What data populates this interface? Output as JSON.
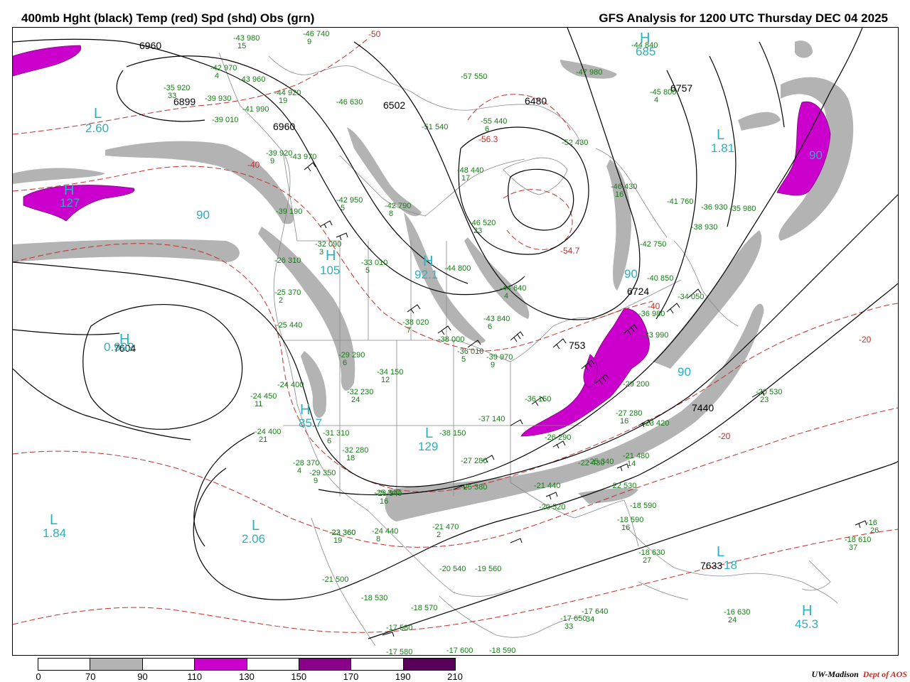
{
  "title_left": "400mb Hght (black) Temp (red) Spd (shd) Obs (grn)",
  "title_right": "GFS Analysis for 1200 UTC Thursday  DEC 04 2025",
  "colors": {
    "height_contour": "#000000",
    "temp_contour": "#c0302a",
    "speed_70_90": "#b3b3b3",
    "speed_110_130": "#cc00cc",
    "obs": "#1a7a1a",
    "pressure_centers": "#2ab0c0",
    "borders": "#888888"
  },
  "legend": {
    "ticks": [
      "0",
      "70",
      "90",
      "110",
      "130",
      "150",
      "170",
      "190",
      "210"
    ],
    "segment_colors": [
      "#ffffff",
      "#b3b3b3",
      "#ffffff",
      "#cc00cc",
      "#ffffff",
      "#8a008a",
      "#ffffff",
      "#5a005a"
    ]
  },
  "credit": {
    "org": "UW-Madison",
    "dept": "Dept of AOS"
  },
  "height_labels": [
    "6960",
    "6960",
    "6899",
    "6502",
    "6480",
    "6757",
    "6724",
    "7604",
    "7440",
    "7633",
    "753"
  ],
  "speed_labels": [
    "90",
    "90",
    "90",
    "90"
  ],
  "temp_labels": [
    "-50",
    "-40",
    "-54.7",
    "-56.3",
    "-40",
    "-20",
    "-20"
  ],
  "centers": [
    {
      "letter": "L",
      "value": "2.60"
    },
    {
      "letter": "H",
      "value": "127"
    },
    {
      "letter": "L",
      "value": "1.81"
    },
    {
      "letter": "H",
      "value": "0.992"
    },
    {
      "letter": "L",
      "value": "1.84"
    },
    {
      "letter": "L",
      "value": "2.06"
    },
    {
      "letter": "L",
      "value": "129"
    },
    {
      "letter": "H",
      "value": "85.7"
    },
    {
      "letter": "H",
      "value": "45.3"
    },
    {
      "letter": "L",
      "value": "18"
    },
    {
      "letter": "H",
      "value": "105"
    },
    {
      "letter": "H",
      "value": "92.1"
    },
    {
      "letter": "H",
      "value": "685"
    }
  ],
  "observations": [
    {
      "temp": "-43",
      "hgt": "980",
      "dew": "15"
    },
    {
      "temp": "-46",
      "hgt": "740",
      "dew": "9"
    },
    {
      "temp": "-42",
      "hgt": "970",
      "dew": "4"
    },
    {
      "temp": "-43",
      "hgt": "960",
      "dew": ""
    },
    {
      "temp": "-35",
      "hgt": "920",
      "dew": "33"
    },
    {
      "temp": "-39",
      "hgt": "930",
      "dew": ""
    },
    {
      "temp": "-44",
      "hgt": "920",
      "dew": "19"
    },
    {
      "temp": "-46",
      "hgt": "630",
      "dew": ""
    },
    {
      "temp": "-57",
      "hgt": "550",
      "dew": ""
    },
    {
      "temp": "-44",
      "hgt": "840",
      "dew": ""
    },
    {
      "temp": "-47",
      "hgt": "980",
      "dew": ""
    },
    {
      "temp": "-45",
      "hgt": "800",
      "dew": "4"
    },
    {
      "temp": "-41",
      "hgt": "990",
      "dew": ""
    },
    {
      "temp": "-39",
      "hgt": "010",
      "dew": ""
    },
    {
      "temp": "-51",
      "hgt": "540",
      "dew": ""
    },
    {
      "temp": "-55",
      "hgt": "440",
      "dew": "6"
    },
    {
      "temp": "-52",
      "hgt": "430",
      "dew": ""
    },
    {
      "temp": "-36",
      "hgt": "930",
      "dew": ""
    },
    {
      "temp": "-39",
      "hgt": "920",
      "dew": "9"
    },
    {
      "temp": "-43",
      "hgt": "970",
      "dew": ""
    },
    {
      "temp": "-48",
      "hgt": "440",
      "dew": "17"
    },
    {
      "temp": "-46",
      "hgt": "430",
      "dew": "16"
    },
    {
      "temp": "-41",
      "hgt": "760",
      "dew": ""
    },
    {
      "temp": "-35",
      "hgt": "980",
      "dew": ""
    },
    {
      "temp": "-42",
      "hgt": "950",
      "dew": "5"
    },
    {
      "temp": "-42",
      "hgt": "790",
      "dew": "8"
    },
    {
      "temp": "-46",
      "hgt": "520",
      "dew": "23"
    },
    {
      "temp": "-38",
      "hgt": "930",
      "dew": ""
    },
    {
      "temp": "-39",
      "hgt": "190",
      "dew": ""
    },
    {
      "temp": "-32",
      "hgt": "090",
      "dew": "3"
    },
    {
      "temp": "-42",
      "hgt": "750",
      "dew": ""
    },
    {
      "temp": "-26",
      "hgt": "310",
      "dew": ""
    },
    {
      "temp": "-33",
      "hgt": "010",
      "dew": "5"
    },
    {
      "temp": "-44",
      "hgt": "800",
      "dew": ""
    },
    {
      "temp": "-40",
      "hgt": "850",
      "dew": ""
    },
    {
      "temp": "-25",
      "hgt": "370",
      "dew": "2"
    },
    {
      "temp": "-44",
      "hgt": "640",
      "dew": "4"
    },
    {
      "temp": "-34",
      "hgt": "050",
      "dew": ""
    },
    {
      "temp": "-25",
      "hgt": "440",
      "dew": ""
    },
    {
      "temp": "-38",
      "hgt": "020",
      "dew": "7"
    },
    {
      "temp": "-43",
      "hgt": "840",
      "dew": "6"
    },
    {
      "temp": "-36",
      "hgt": "980",
      "dew": ""
    },
    {
      "temp": "-38",
      "hgt": "000",
      "dew": ""
    },
    {
      "temp": "-29",
      "hgt": "290",
      "dew": "6"
    },
    {
      "temp": "-36",
      "hgt": "010",
      "dew": "5"
    },
    {
      "temp": "-39",
      "hgt": "970",
      "dew": "9"
    },
    {
      "temp": "-33",
      "hgt": "990",
      "dew": ""
    },
    {
      "temp": "-34",
      "hgt": "150",
      "dew": "12"
    },
    {
      "temp": "-24",
      "hgt": "400",
      "dew": ""
    },
    {
      "temp": "-24",
      "hgt": "450",
      "dew": "11"
    },
    {
      "temp": "-32",
      "hgt": "230",
      "dew": "24"
    },
    {
      "temp": "-36",
      "hgt": "150",
      "dew": ""
    },
    {
      "temp": "-29",
      "hgt": "200",
      "dew": ""
    },
    {
      "temp": "-20",
      "hgt": "530",
      "dew": "23"
    },
    {
      "temp": "-24",
      "hgt": "400",
      "dew": "21"
    },
    {
      "temp": "-31",
      "hgt": "310",
      "dew": "6"
    },
    {
      "temp": "-38",
      "hgt": "150",
      "dew": ""
    },
    {
      "temp": "-37",
      "hgt": "140",
      "dew": ""
    },
    {
      "temp": "-27",
      "hgt": "280",
      "dew": ""
    },
    {
      "temp": "-23",
      "hgt": "420",
      "dew": ""
    },
    {
      "temp": "-32",
      "hgt": "280",
      "dew": "18"
    },
    {
      "temp": "-26",
      "hgt": "290",
      "dew": ""
    },
    {
      "temp": "-28",
      "hgt": "370",
      "dew": "4"
    },
    {
      "temp": "-27",
      "hgt": "280",
      "dew": "16"
    },
    {
      "temp": "-21",
      "hgt": "480",
      "dew": "14"
    },
    {
      "temp": "-25",
      "hgt": "340",
      "dew": ""
    },
    {
      "temp": "-29",
      "hgt": "350",
      "dew": "9"
    },
    {
      "temp": "-25",
      "hgt": "340",
      "dew": ""
    },
    {
      "temp": "-22",
      "hgt": "430",
      "dew": ""
    },
    {
      "temp": "-23",
      "hgt": "360",
      "dew": ""
    },
    {
      "temp": "-26",
      "hgt": "340",
      "dew": "16"
    },
    {
      "temp": "-25",
      "hgt": "380",
      "dew": ""
    },
    {
      "temp": "-21",
      "hgt": "440",
      "dew": ""
    },
    {
      "temp": "-22",
      "hgt": "530",
      "dew": ""
    },
    {
      "temp": "-18",
      "hgt": "590",
      "dew": ""
    },
    {
      "temp": "-22",
      "hgt": "360",
      "dew": "19"
    },
    {
      "temp": "-24",
      "hgt": "440",
      "dew": "8"
    },
    {
      "temp": "-21",
      "hgt": "470",
      "dew": "2"
    },
    {
      "temp": "-20",
      "hgt": "520",
      "dew": ""
    },
    {
      "temp": "-18",
      "hgt": "590",
      "dew": "16"
    },
    {
      "temp": "-16",
      "hgt": "",
      "dew": "26"
    },
    {
      "temp": "-21",
      "hgt": "500",
      "dew": ""
    },
    {
      "temp": "-20",
      "hgt": "540",
      "dew": ""
    },
    {
      "temp": "-19",
      "hgt": "560",
      "dew": ""
    },
    {
      "temp": "-18",
      "hgt": "630",
      "dew": "27"
    },
    {
      "temp": "-18",
      "hgt": "610",
      "dew": "37"
    },
    {
      "temp": "-18",
      "hgt": "530",
      "dew": ""
    },
    {
      "temp": "-18",
      "hgt": "570",
      "dew": ""
    },
    {
      "temp": "-17",
      "hgt": "650",
      "dew": "33"
    },
    {
      "temp": "-17",
      "hgt": "640",
      "dew": "34"
    },
    {
      "temp": "-16",
      "hgt": "630",
      "dew": "24"
    },
    {
      "temp": "-17",
      "hgt": "580",
      "dew": ""
    },
    {
      "temp": "-17",
      "hgt": "580",
      "dew": ""
    },
    {
      "temp": "-17",
      "hgt": "600",
      "dew": ""
    },
    {
      "temp": "-18",
      "hgt": "590",
      "dew": ""
    }
  ]
}
